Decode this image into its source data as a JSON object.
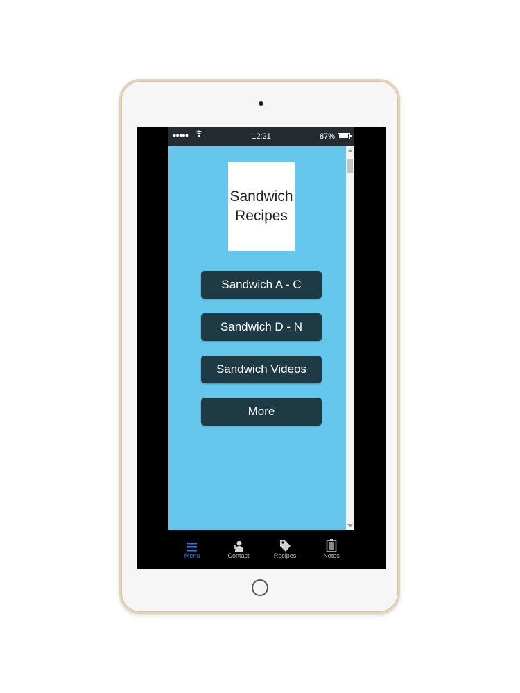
{
  "status_bar": {
    "signal": "●●●●●",
    "time": "12:21",
    "battery": "87%"
  },
  "logo": {
    "line1": "Sandwich",
    "line2": "Recipes"
  },
  "menu": [
    {
      "label": "Sandwich A - C"
    },
    {
      "label": "Sandwich D - N"
    },
    {
      "label": "Sandwich Videos"
    },
    {
      "label": "More"
    }
  ],
  "tabs": [
    {
      "label": "Menu",
      "icon": "menu-icon",
      "active": true
    },
    {
      "label": "Contact",
      "icon": "contact-icon"
    },
    {
      "label": "Recipes",
      "icon": "tag-icon"
    },
    {
      "label": "Notes",
      "icon": "notes-icon"
    }
  ],
  "colors": {
    "background": "#66c7ec",
    "button": "#1e3a45",
    "active_tab": "#2f7be6"
  }
}
